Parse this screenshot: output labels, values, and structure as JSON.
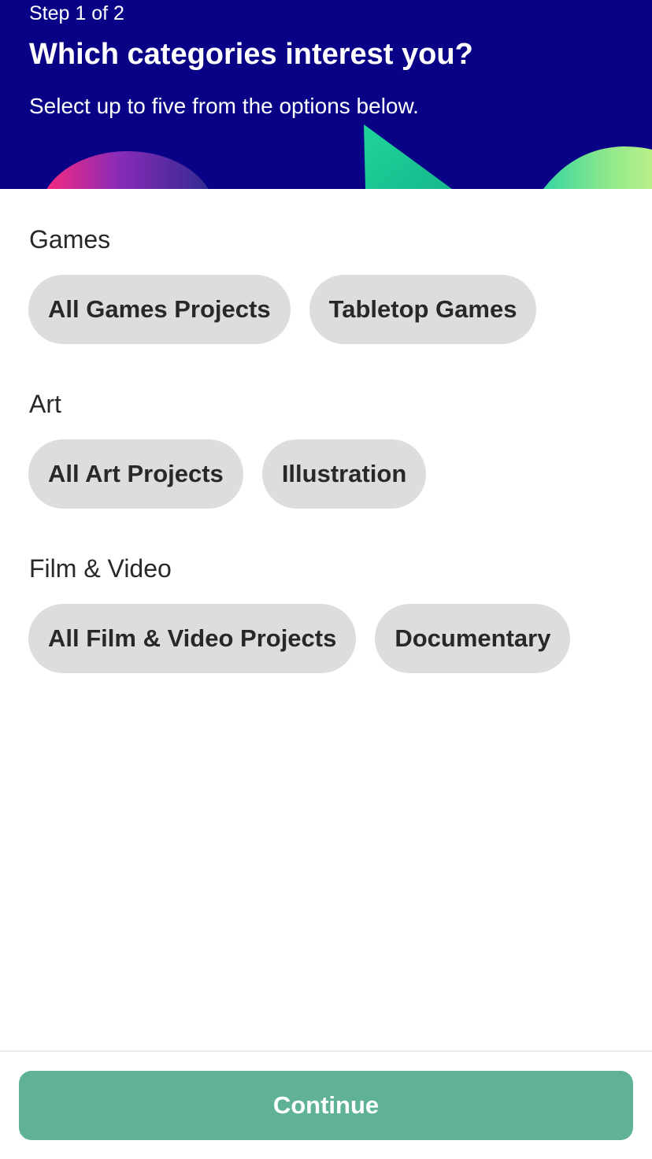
{
  "header": {
    "step_label": "Step 1 of 2",
    "title": "Which categories interest you?",
    "subtitle": "Select up to five from the options below.",
    "background_color": "#0a0286"
  },
  "sections": [
    {
      "title": "Games",
      "chips": [
        "All Games Projects",
        "Tabletop Games"
      ]
    },
    {
      "title": "Art",
      "chips": [
        "All Art Projects",
        "Illustration"
      ]
    },
    {
      "title": "Film & Video",
      "chips": [
        "All Film & Video Projects",
        "Documentary"
      ]
    }
  ],
  "footer": {
    "continue_label": "Continue",
    "button_color": "#5fb394"
  },
  "colors": {
    "chip_background": "#dcdedd",
    "text": "#282828",
    "accent": "#5fb394"
  }
}
